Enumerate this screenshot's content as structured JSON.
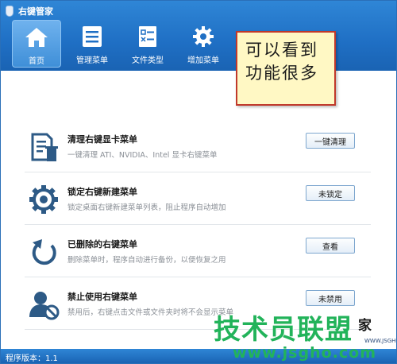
{
  "app": {
    "title": "右键管家"
  },
  "nav": [
    {
      "label": "首页",
      "icon": "home-icon",
      "active": true
    },
    {
      "label": "管理菜单",
      "icon": "menu-list-icon",
      "active": false
    },
    {
      "label": "文件类型",
      "icon": "file-type-icon",
      "active": false
    },
    {
      "label": "增加菜单",
      "icon": "gear-icon",
      "active": false
    }
  ],
  "callout": {
    "line1": "可以看到",
    "line2": "功能很多"
  },
  "rows": [
    {
      "title": "清理右键显卡菜单",
      "desc": "一键清理 ATI、NVIDIA、Intel 显卡右键菜单",
      "button": "一键清理",
      "icon": "clean-document-icon"
    },
    {
      "title": "锁定右键新建菜单",
      "desc": "锁定桌面右键新建菜单列表，阻止程序自动增加",
      "button": "未锁定",
      "icon": "gear-icon"
    },
    {
      "title": "已删除的右键菜单",
      "desc": "删除菜单时，程序自动进行备份，以便恢复之用",
      "button": "查看",
      "icon": "restore-arrow-icon"
    },
    {
      "title": "禁止使用右键菜单",
      "desc": "禁用后，右键点击文件或文件夹时将不会显示菜单",
      "button": "未禁用",
      "icon": "user-block-icon"
    }
  ],
  "status": {
    "version": "程序版本：1.1"
  },
  "watermark": {
    "main": "技术员联盟",
    "side": "家",
    "url": "www.jsgho.com",
    "sub": "WWW.JSGHO.NET"
  },
  "colors": {
    "header": "#1f6fc4",
    "callout_bg": "#fff8c4",
    "callout_border": "#c0392b",
    "watermark": "#22b35a"
  }
}
